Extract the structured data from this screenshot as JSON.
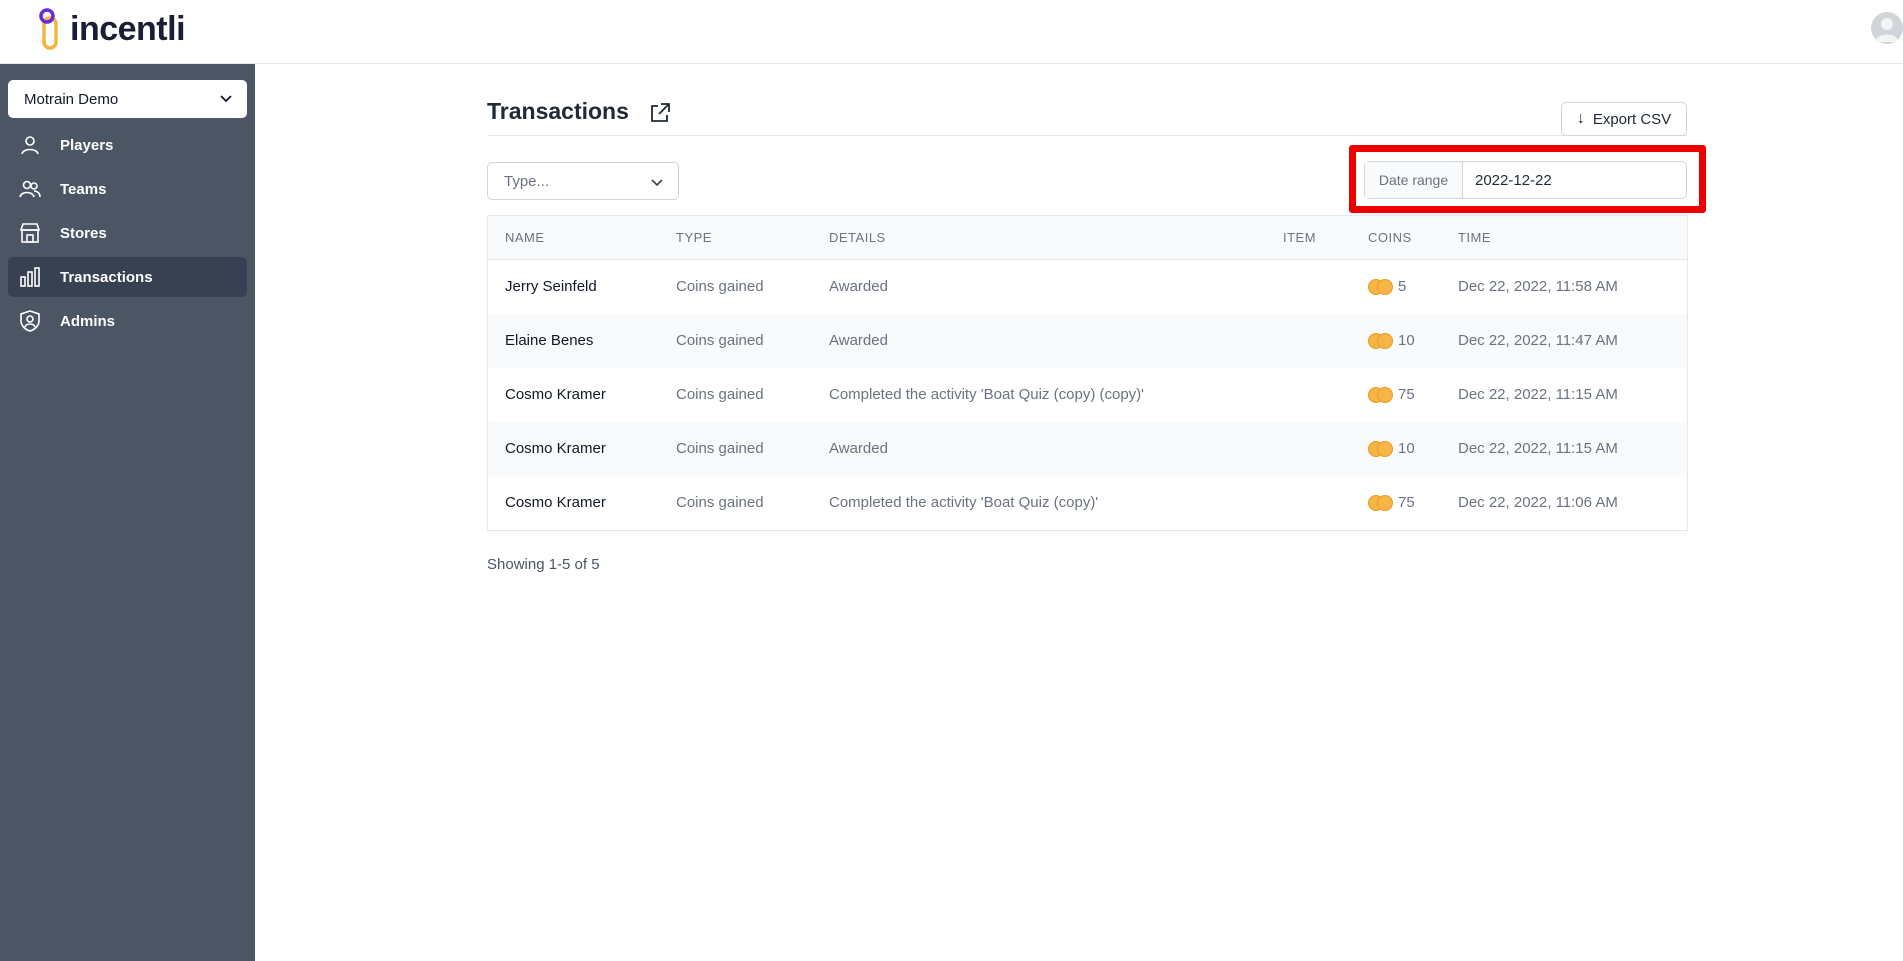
{
  "header": {
    "logo_text": "incentli",
    "brand_colors": {
      "purple": "#6d28d9",
      "gold": "#f0b63e"
    }
  },
  "sidebar": {
    "account": "Motrain Demo",
    "items": [
      {
        "label": "Players",
        "icon": "user-icon",
        "active": false
      },
      {
        "label": "Teams",
        "icon": "users-icon",
        "active": false
      },
      {
        "label": "Stores",
        "icon": "store-icon",
        "active": false
      },
      {
        "label": "Transactions",
        "icon": "chart-bar-icon",
        "active": true
      },
      {
        "label": "Admins",
        "icon": "shield-user-icon",
        "active": false
      }
    ]
  },
  "main": {
    "title": "Transactions",
    "export_label": "Export CSV",
    "type_placeholder": "Type...",
    "date_range_label": "Date range",
    "date_range_value": "2022-12-22",
    "highlight_color": "#ee0000",
    "table": {
      "columns": [
        "NAME",
        "TYPE",
        "DETAILS",
        "ITEM",
        "COINS",
        "TIME"
      ],
      "rows": [
        {
          "name": "Jerry Seinfeld",
          "type": "Coins gained",
          "details": "Awarded",
          "item": "",
          "coins": "5",
          "time": "Dec 22, 2022, 11:58 AM"
        },
        {
          "name": "Elaine Benes",
          "type": "Coins gained",
          "details": "Awarded",
          "item": "",
          "coins": "10",
          "time": "Dec 22, 2022, 11:47 AM"
        },
        {
          "name": "Cosmo Kramer",
          "type": "Coins gained",
          "details": "Completed the activity 'Boat Quiz (copy) (copy)'",
          "item": "",
          "coins": "75",
          "time": "Dec 22, 2022, 11:15 AM"
        },
        {
          "name": "Cosmo Kramer",
          "type": "Coins gained",
          "details": "Awarded",
          "item": "",
          "coins": "10",
          "time": "Dec 22, 2022, 11:15 AM"
        },
        {
          "name": "Cosmo Kramer",
          "type": "Coins gained",
          "details": "Completed the activity 'Boat Quiz (copy)'",
          "item": "",
          "coins": "75",
          "time": "Dec 22, 2022, 11:06 AM"
        }
      ]
    },
    "pagination_text": "Showing 1-5 of 5"
  }
}
